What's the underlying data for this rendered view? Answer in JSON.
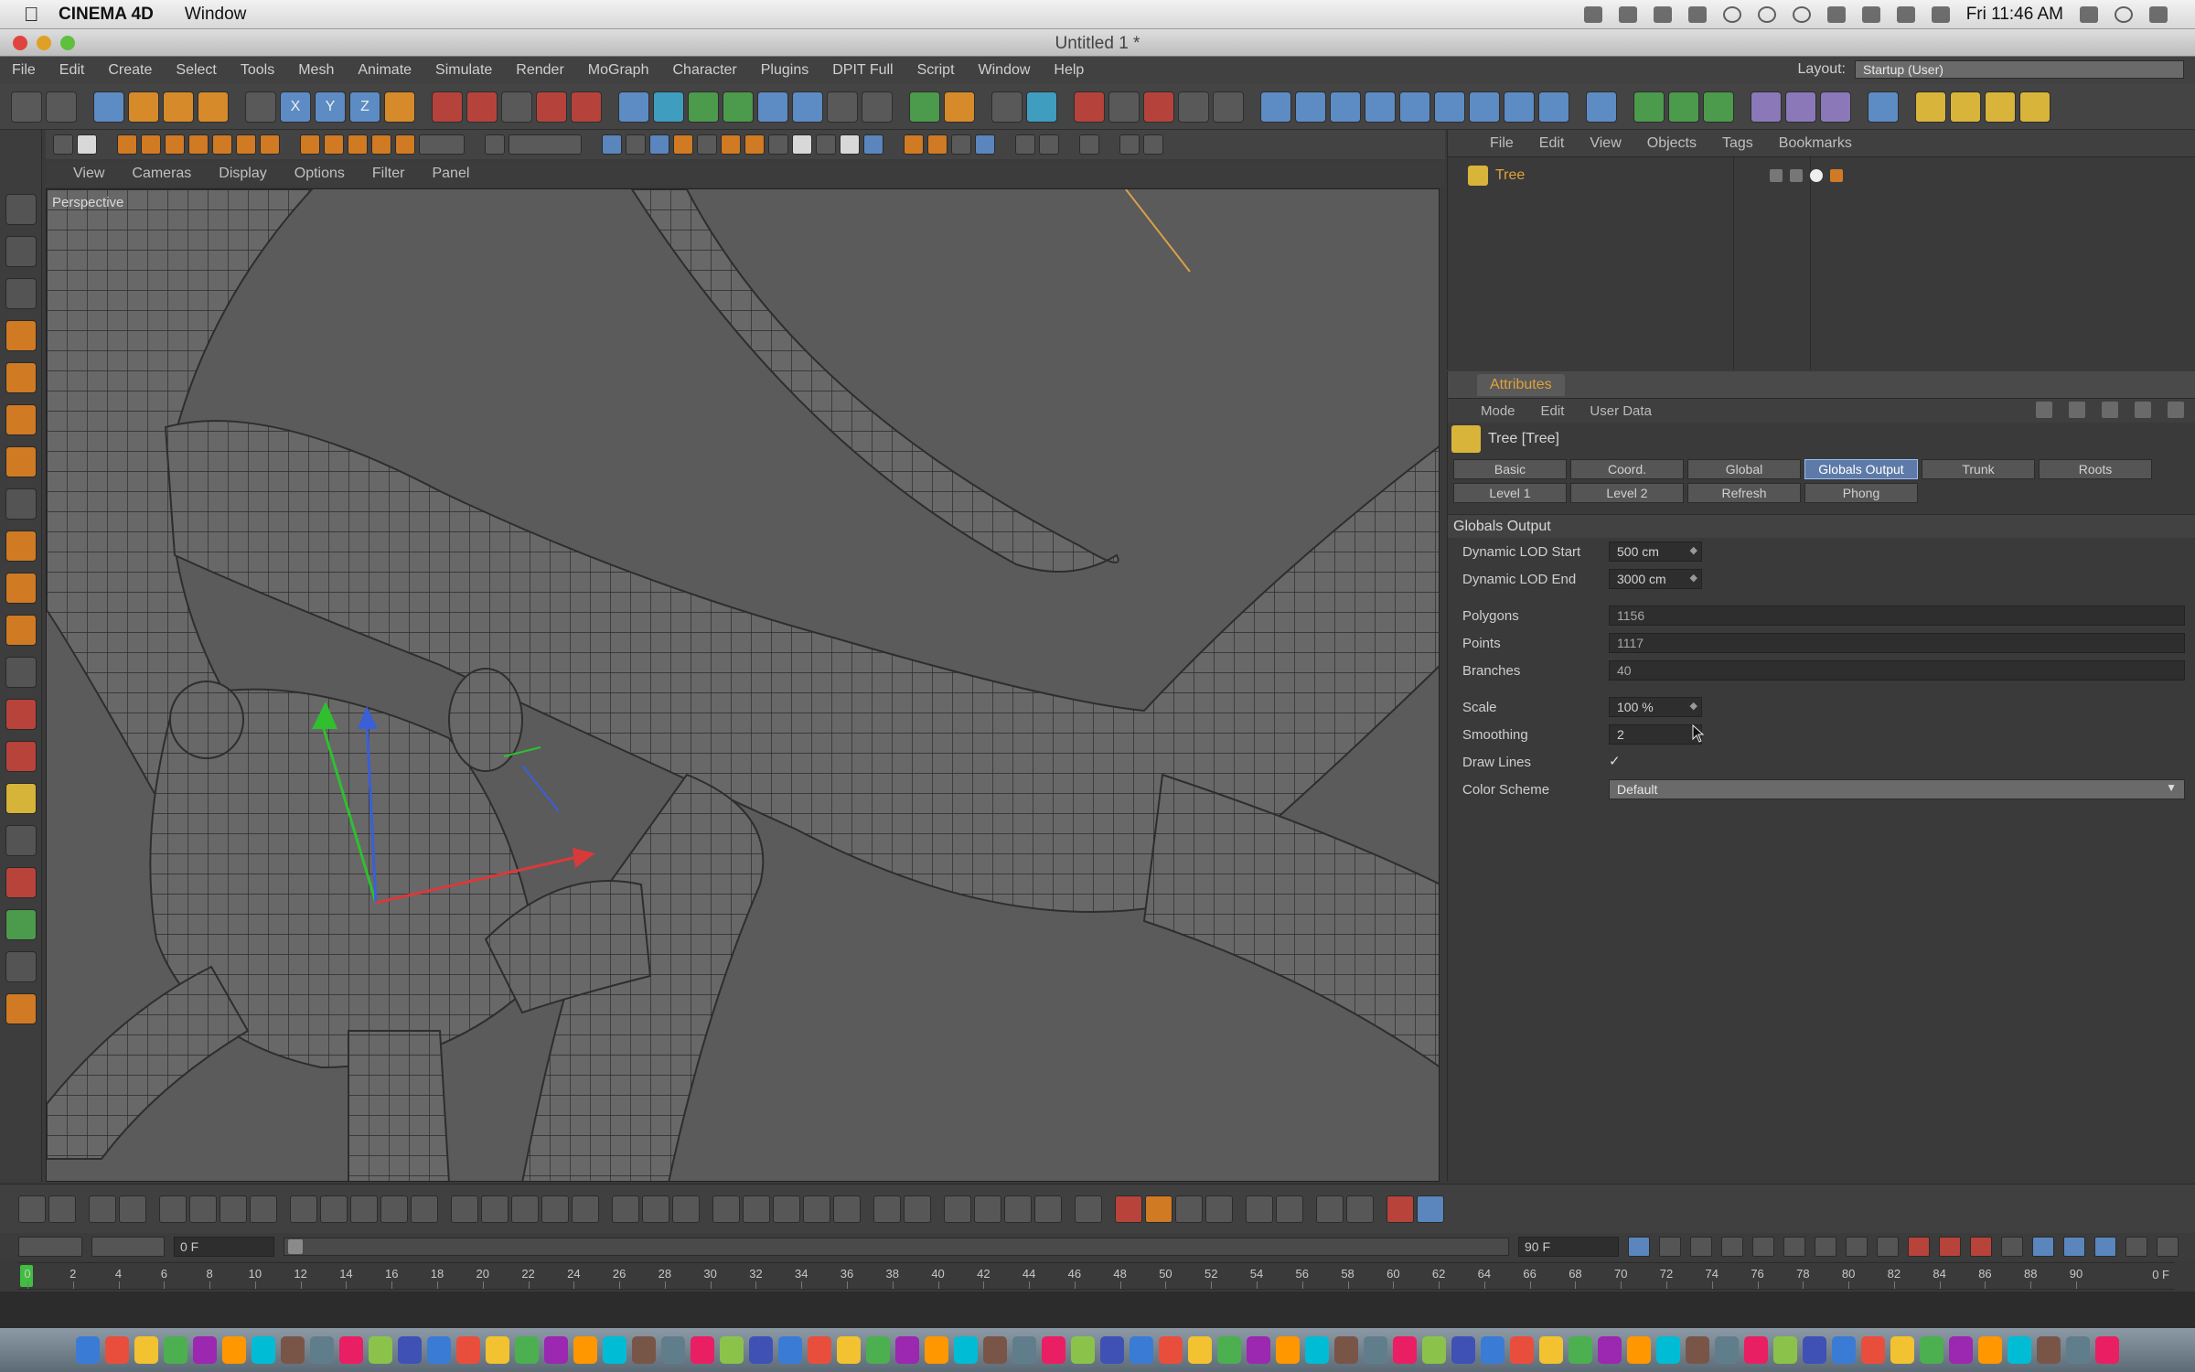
{
  "mac_menubar": {
    "app_name": "CINEMA 4D",
    "menus": [
      "Window"
    ],
    "clock": "Fri 11:46 AM"
  },
  "window": {
    "title": "Untitled 1 *"
  },
  "c4d_menubar": {
    "menus": [
      "File",
      "Edit",
      "Create",
      "Select",
      "Tools",
      "Mesh",
      "Animate",
      "Simulate",
      "Render",
      "MoGraph",
      "Character",
      "Plugins",
      "DPIT Full",
      "Script",
      "Window",
      "Help"
    ],
    "layout_label": "Layout:",
    "layout_value": "Startup (User)"
  },
  "viewport": {
    "menu": [
      "View",
      "Cameras",
      "Display",
      "Options",
      "Filter",
      "Panel"
    ],
    "label": "Perspective"
  },
  "object_manager": {
    "menu": [
      "File",
      "Edit",
      "View",
      "Objects",
      "Tags",
      "Bookmarks"
    ],
    "objects": [
      {
        "name": "Tree"
      }
    ]
  },
  "attributes": {
    "tab_label": "Attributes",
    "sub_menu": [
      "Mode",
      "Edit",
      "User Data"
    ],
    "object_title": "Tree [Tree]",
    "tabs_row1": [
      "Basic",
      "Coord.",
      "Global",
      "Globals Output",
      "Trunk",
      "Roots"
    ],
    "tabs_row2": [
      "Level 1",
      "Level 2",
      "Refresh",
      "Phong"
    ],
    "active_tab": "Globals Output",
    "section_title": "Globals Output",
    "fields": {
      "lod_start": {
        "label": "Dynamic LOD Start",
        "value": "500 cm"
      },
      "lod_end": {
        "label": "Dynamic LOD End",
        "value": "3000 cm"
      },
      "polygons": {
        "label": "Polygons",
        "value": "1156"
      },
      "points": {
        "label": "Points",
        "value": "1117"
      },
      "branches": {
        "label": "Branches",
        "value": "40"
      },
      "scale": {
        "label": "Scale",
        "value": "100 %"
      },
      "smoothing": {
        "label": "Smoothing",
        "value": "2"
      },
      "draw_lines": {
        "label": "Draw Lines",
        "checked": true,
        "mark": "✓"
      },
      "color_scheme": {
        "label": "Color Scheme",
        "value": "Default"
      }
    }
  },
  "timeline": {
    "start_field": "0 F",
    "end_field": "90 F",
    "ticks": [
      "0",
      "2",
      "4",
      "6",
      "8",
      "10",
      "12",
      "14",
      "16",
      "18",
      "20",
      "22",
      "24",
      "26",
      "28",
      "30",
      "32",
      "34",
      "36",
      "38",
      "40",
      "42",
      "44",
      "46",
      "48",
      "50",
      "52",
      "54",
      "56",
      "58",
      "60",
      "62",
      "64",
      "66",
      "68",
      "70",
      "72",
      "74",
      "76",
      "78",
      "80",
      "82",
      "84",
      "86",
      "88",
      "90"
    ],
    "current_frame_label": "0 F"
  },
  "colors": {
    "accent_orange": "#e0a23a",
    "active_tab_blue": "#5e7aa8",
    "viewport_bg": "#5b5b5b"
  }
}
